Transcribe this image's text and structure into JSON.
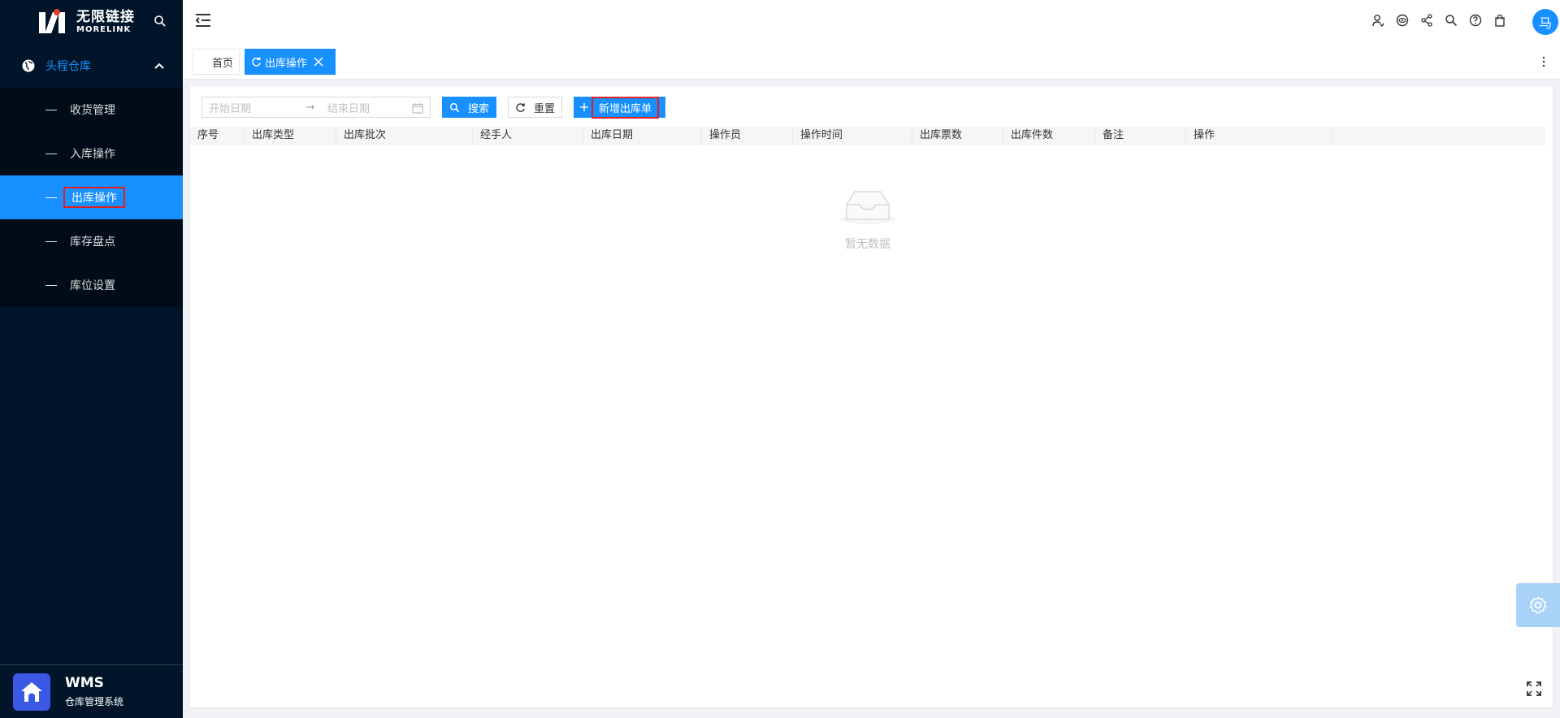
{
  "logo": {
    "cn": "无限链接",
    "en": "MORELINK"
  },
  "sidebar": {
    "group_label": "头程仓库",
    "items": [
      {
        "label": "收货管理"
      },
      {
        "label": "入库操作"
      },
      {
        "label": "出库操作"
      },
      {
        "label": "库存盘点"
      },
      {
        "label": "库位设置"
      }
    ],
    "footer_title": "WMS",
    "footer_subtitle": "仓库管理系统"
  },
  "header": {
    "avatar_text": "马"
  },
  "tabs": {
    "home": "首页",
    "active": "出库操作"
  },
  "toolbar": {
    "start_placeholder": "开始日期",
    "range_separator": "→",
    "end_placeholder": "结束日期",
    "search_label": "搜索",
    "reset_label": "重置",
    "add_label": "新增出库单"
  },
  "table": {
    "columns": [
      "序号",
      "出库类型",
      "出库批次",
      "经手人",
      "出库日期",
      "操作员",
      "操作时间",
      "出库票数",
      "出库件数",
      "备注",
      "操作"
    ],
    "empty_text": "暂无数据"
  },
  "colors": {
    "primary": "#1890ff",
    "sidebar_bg": "#001529",
    "highlight": "#e02020"
  }
}
